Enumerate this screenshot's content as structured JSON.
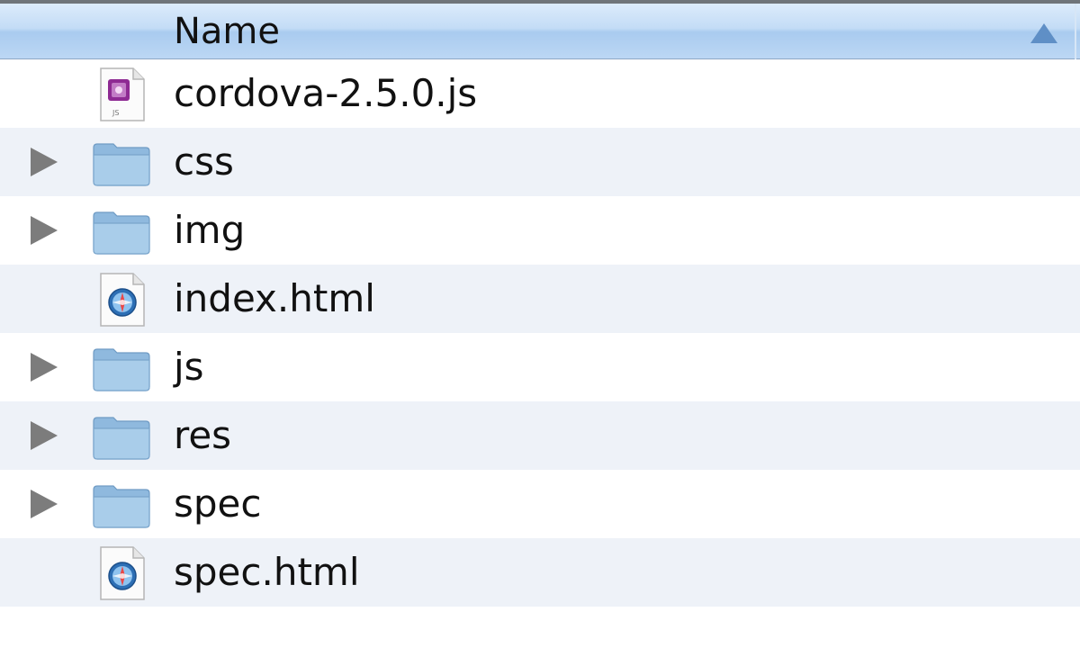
{
  "header": {
    "name_label": "Name",
    "sort_direction": "ascending"
  },
  "files": [
    {
      "name": "cordova-2.5.0.js",
      "kind": "file",
      "icon": "js-file-icon",
      "expandable": false,
      "icon_caption": "JS"
    },
    {
      "name": "css",
      "kind": "folder",
      "icon": "folder-icon",
      "expandable": true
    },
    {
      "name": "img",
      "kind": "folder",
      "icon": "folder-icon",
      "expandable": true
    },
    {
      "name": "index.html",
      "kind": "file",
      "icon": "html-file-icon",
      "expandable": false
    },
    {
      "name": "js",
      "kind": "folder",
      "icon": "folder-icon",
      "expandable": true
    },
    {
      "name": "res",
      "kind": "folder",
      "icon": "folder-icon",
      "expandable": true
    },
    {
      "name": "spec",
      "kind": "folder",
      "icon": "folder-icon",
      "expandable": true
    },
    {
      "name": "spec.html",
      "kind": "file",
      "icon": "html-file-icon",
      "expandable": false
    }
  ],
  "colors": {
    "header_gradient_top": "#dcebfb",
    "header_gradient_bottom": "#a9cbef",
    "sort_arrow": "#5f8fc6",
    "row_alternate": "#eef2f8",
    "folder": "#9cc3e4",
    "disclosure_triangle": "#7c7c7c"
  }
}
